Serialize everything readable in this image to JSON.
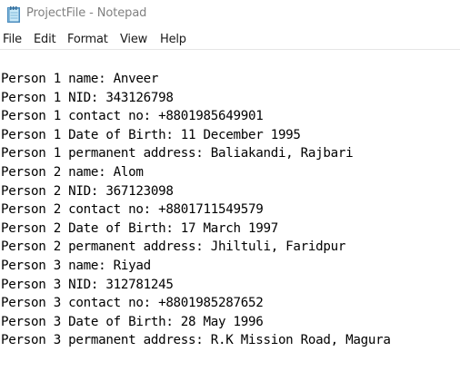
{
  "window": {
    "title": "ProjectFile - Notepad",
    "icon": "notepad-icon"
  },
  "menu": {
    "items": [
      {
        "label": "File"
      },
      {
        "label": "Edit"
      },
      {
        "label": "Format"
      },
      {
        "label": "View"
      },
      {
        "label": "Help"
      }
    ]
  },
  "editor": {
    "lines": [
      "Person 1 name: Anveer",
      "Person 1 NID: 343126798",
      "Person 1 contact no: +8801985649901",
      "Person 1 Date of Birth: 11 December 1995",
      "Person 1 permanent address: Baliakandi, Rajbari",
      "Person 2 name: Alom",
      "Person 2 NID: 367123098",
      "Person 2 contact no: +8801711549579",
      "Person 2 Date of Birth: 17 March 1997",
      "Person 2 permanent address: Jhiltuli, Faridpur",
      "Person 3 name: Riyad",
      "Person 3 NID: 312781245",
      "Person 3 contact no: +8801985287652",
      "Person 3 Date of Birth: 28 May 1996",
      "Person 3 permanent address: R.K Mission Road, Magura"
    ]
  }
}
